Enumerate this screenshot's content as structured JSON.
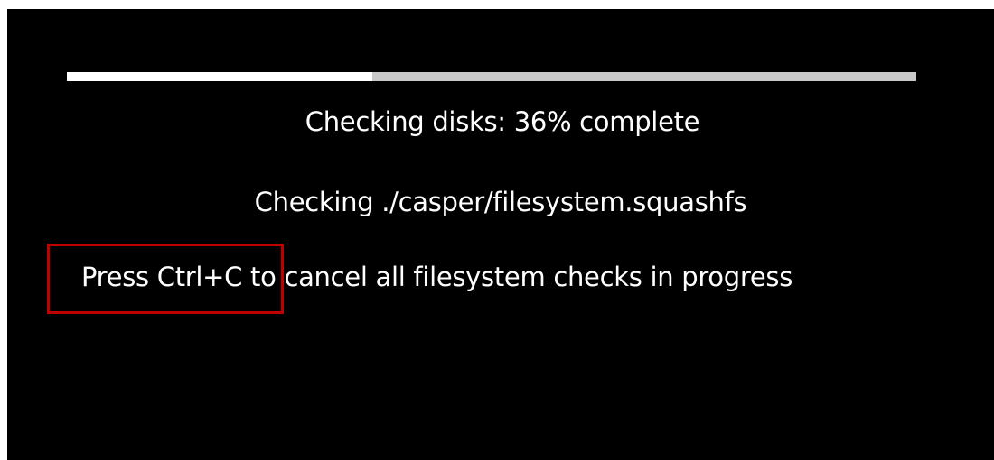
{
  "progress": {
    "fraction": 0.36,
    "fill_color": "#ffffff",
    "track_color": "#c9c9c9"
  },
  "status_line": "Checking disks: 36% complete",
  "current_file_line": "Checking ./casper/filesystem.squashfs",
  "cancel_hint": "Press Ctrl+C to cancel all filesystem checks in progress",
  "highlight_color": "#c00000"
}
